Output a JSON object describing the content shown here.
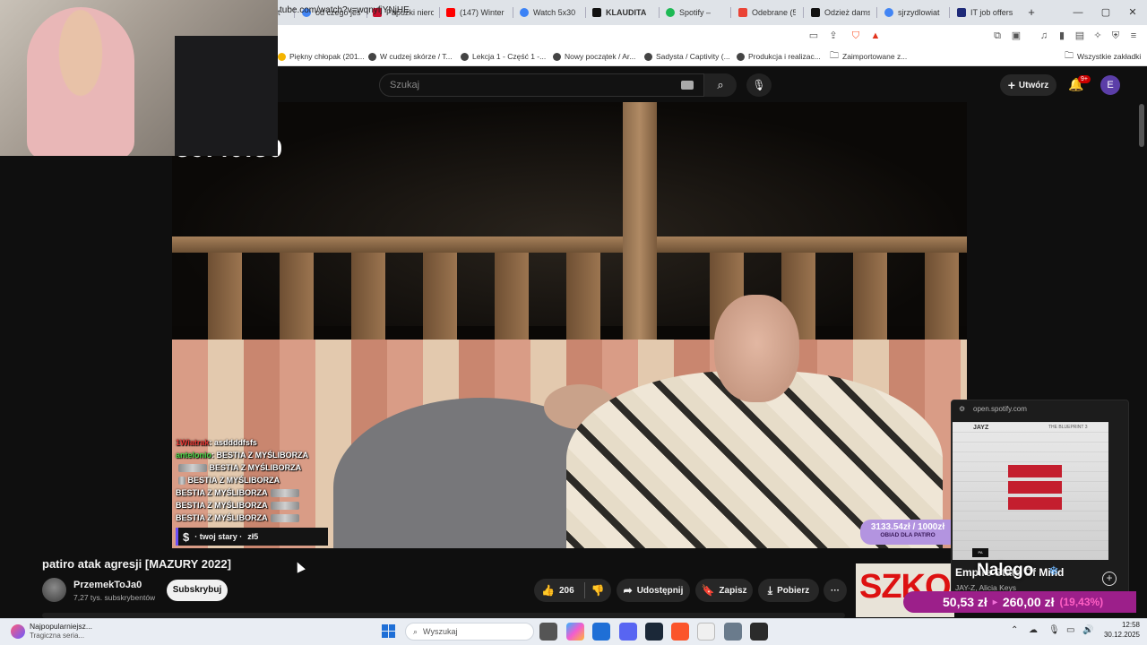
{
  "browser": {
    "tabs": [
      {
        "label": "od czego jest",
        "color": "#4285f4"
      },
      {
        "label": "Papużki niero",
        "color": "#c8102e"
      },
      {
        "label": "(147) Winter",
        "color": "#ff0000"
      },
      {
        "label": "Watch 5x30",
        "color": "#3b82f6"
      },
      {
        "label": "KLAUDITA",
        "color": "#111111"
      },
      {
        "label": "Spotify –",
        "color": "#1db954"
      },
      {
        "label": "Odebrane (5",
        "color": "#ea4335"
      },
      {
        "label": "Odzież dams",
        "color": "#111111"
      },
      {
        "label": "sjrzydlowiat",
        "color": "#4285f4"
      },
      {
        "label": "IT job offers",
        "color": "#1e2a78"
      }
    ],
    "new_tab": "+",
    "win_min": "—",
    "win_max": "▢",
    "win_close": "✕",
    "url": "tube.com/watch?v=wqnyfjYNjHE",
    "bookmarks": [
      "Piękny chłopak (201...",
      "W cudzej skórze / T...",
      "Lekcja 1 - Część 1 -...",
      "Nowy początek / Ar...",
      "Sadysta / Captivity (...",
      "Produkcja i realizac...",
      "Zaimportowane z..."
    ],
    "all_bookmarks": "Wszystkie zakładki"
  },
  "youtube": {
    "search_placeholder": "Szukaj",
    "create_label": "Utwórz",
    "notif_badge": "9+",
    "avatar_letter": "E",
    "video_title": "patiro atak agresji [MAZURY 2022]",
    "channel_name": "PrzemekToJa0",
    "subscribers": "7,27 tys. subskrybentów",
    "subscribe_label": "Subskrybuj",
    "likes": "206",
    "share_label": "Udostępnij",
    "save_label": "Zapisz",
    "download_label": "Pobierz",
    "more_label": "···"
  },
  "stream_overlay": {
    "timer": "39:40:30",
    "chat": [
      {
        "user": "1Wiatrak",
        "text": ": asddddfsfs"
      },
      {
        "user": "antelonio",
        "text": ": BESTIA Z MYŚLIBORZA"
      },
      {
        "user": "",
        "text": "BESTIA Z MYŚLIBORZA"
      },
      {
        "user": "",
        "text": "BESTIA Z MYŚLIBORZA"
      },
      {
        "user": "",
        "text": "BESTIA Z MYŚLIBORZA"
      },
      {
        "user": "",
        "text": "BESTIA Z MYŚLIBORZA"
      },
      {
        "user": "",
        "text": "BESTIA Z MYŚLIBORZA"
      }
    ],
    "donation_text": "· twoj stary ·",
    "donation_amount": "zł5",
    "goal_amount": "3133.54zł / 1000zł",
    "goal_label": "OBIAD DLA PATIRO",
    "overlay_name": "Nalego",
    "price_current": "50,53 zł",
    "price_target": "260,00 zł",
    "price_pct": "(19,43%)"
  },
  "spotify": {
    "url": "open.spotify.com",
    "track": "Empire State Of Mind",
    "artist": "JAY-Z, Alicia Keys",
    "album_artist_tag": "JAYZ",
    "album_tag": "THE BLUEPRINT 3"
  },
  "ad": {
    "text": "SZKO"
  },
  "taskbar": {
    "news_title": "Najpopularniejsz...",
    "news_sub": "Tragiczna seria...",
    "search_placeholder": "Wyszukaj",
    "time": "12:58",
    "date": "30.12.2025"
  }
}
